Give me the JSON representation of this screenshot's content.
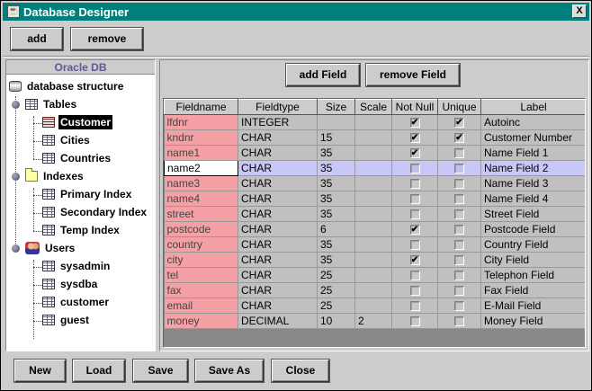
{
  "window": {
    "title": "Database Designer",
    "close_label": "X"
  },
  "toolbar": {
    "add_label": "add",
    "remove_label": "remove"
  },
  "left_panel": {
    "header": "Oracle DB",
    "root": "database structure",
    "groups": [
      {
        "label": "Tables",
        "items": [
          "Customer",
          "Cities",
          "Countries"
        ],
        "selected_index": 0
      },
      {
        "label": "Indexes",
        "items": [
          "Primary Index",
          "Secondary Index",
          "Temp Index"
        ]
      },
      {
        "label": "Users",
        "items": [
          "sysadmin",
          "sysdba",
          "customer",
          "guest"
        ]
      }
    ]
  },
  "field_toolbar": {
    "add_field_label": "add Field",
    "remove_field_label": "remove Field"
  },
  "grid": {
    "columns": [
      "Fieldname",
      "Fieldtype",
      "Size",
      "Scale",
      "Not Null",
      "Unique",
      "Label"
    ],
    "selected_row": 3,
    "rows": [
      {
        "fieldname": "lfdnr",
        "fieldtype": "INTEGER",
        "size": "",
        "scale": "",
        "not_null": true,
        "unique": true,
        "label": "Autoinc"
      },
      {
        "fieldname": "kndnr",
        "fieldtype": "CHAR",
        "size": "15",
        "scale": "",
        "not_null": true,
        "unique": true,
        "label": "Customer Number"
      },
      {
        "fieldname": "name1",
        "fieldtype": "CHAR",
        "size": "35",
        "scale": "",
        "not_null": true,
        "unique": false,
        "label": "Name Field 1"
      },
      {
        "fieldname": "name2",
        "fieldtype": "CHAR",
        "size": "35",
        "scale": "",
        "not_null": false,
        "unique": false,
        "label": "Name Field 2"
      },
      {
        "fieldname": "name3",
        "fieldtype": "CHAR",
        "size": "35",
        "scale": "",
        "not_null": false,
        "unique": false,
        "label": "Name Field 3"
      },
      {
        "fieldname": "name4",
        "fieldtype": "CHAR",
        "size": "35",
        "scale": "",
        "not_null": false,
        "unique": false,
        "label": "Name Field 4"
      },
      {
        "fieldname": "street",
        "fieldtype": "CHAR",
        "size": "35",
        "scale": "",
        "not_null": false,
        "unique": false,
        "label": "Street Field"
      },
      {
        "fieldname": "postcode",
        "fieldtype": "CHAR",
        "size": "6",
        "scale": "",
        "not_null": true,
        "unique": false,
        "label": "Postcode Field"
      },
      {
        "fieldname": "country",
        "fieldtype": "CHAR",
        "size": "35",
        "scale": "",
        "not_null": false,
        "unique": false,
        "label": "Country Field"
      },
      {
        "fieldname": "city",
        "fieldtype": "CHAR",
        "size": "35",
        "scale": "",
        "not_null": true,
        "unique": false,
        "label": "City Field"
      },
      {
        "fieldname": "tel",
        "fieldtype": "CHAR",
        "size": "25",
        "scale": "",
        "not_null": false,
        "unique": false,
        "label": "Telephon Field"
      },
      {
        "fieldname": "fax",
        "fieldtype": "CHAR",
        "size": "25",
        "scale": "",
        "not_null": false,
        "unique": false,
        "label": "Fax Field"
      },
      {
        "fieldname": "email",
        "fieldtype": "CHAR",
        "size": "25",
        "scale": "",
        "not_null": false,
        "unique": false,
        "label": "E-Mail Field"
      },
      {
        "fieldname": "money",
        "fieldtype": "DECIMAL",
        "size": "10",
        "scale": "2",
        "not_null": false,
        "unique": false,
        "label": "Money Field"
      }
    ]
  },
  "bottom_bar": {
    "new_label": "New",
    "load_label": "Load",
    "save_label": "Save",
    "save_as_label": "Save As",
    "close_label": "Close"
  },
  "colors": {
    "titlebar": "#00807a",
    "fieldname_cell": "#f4a0a4",
    "selected_row": "#c8c8f8",
    "panel_header_text": "#5a5a98"
  }
}
